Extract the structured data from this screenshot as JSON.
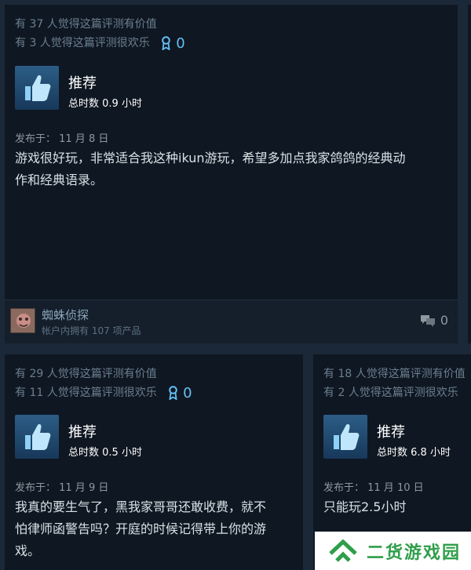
{
  "reviews": [
    {
      "helpful": "有 37 人觉得这篇评测有价值",
      "funny": "有 3 人觉得这篇评测很欢乐",
      "award_count": "0",
      "recommendation": "推荐",
      "hours": "总时数 0.9 小时",
      "posted": "发布于：  11 月 8 日",
      "text_line1": "游戏很好玩，非常适合我这种ikun游玩，希望多加点我家鸽鸽的经典动",
      "text_line2": "作和经典语录。",
      "author": "蜘蛛侦探",
      "products": "帐户内拥有 107 项产品",
      "comment_count": "0"
    },
    {
      "helpful": "有 29 人觉得这篇评测有价值",
      "funny": "有 11 人觉得这篇评测很欢乐",
      "award_count": "0",
      "recommendation": "推荐",
      "hours": "总时数 0.5 小时",
      "posted": "发布于：  11 月 9 日",
      "text_line1": "我真的要生气了，黑我家哥哥还敢收费，就不",
      "text_line2": "怕律师函警告吗？开庭的时候记得带上你的游",
      "text_line3": "戏。"
    },
    {
      "helpful": "有 18 人觉得这篇评测有价值",
      "funny": "有 2 人觉得这篇评测很欢乐",
      "recommendation": "推荐",
      "hours": "总时数 6.8 小时",
      "posted": "发布于：  11 月 10 日",
      "text_line1": "只能玩2.5小时"
    }
  ],
  "watermark": {
    "text": "二货游戏园"
  },
  "icons": {
    "thumb": "thumbs-up-icon",
    "award": "award-ribbon-icon",
    "comment": "comment-bubbles-icon"
  },
  "colors": {
    "background": "#1b2838",
    "card": "#0f1722",
    "accent": "#66c0f4",
    "watermark": "#2f9e4a"
  }
}
